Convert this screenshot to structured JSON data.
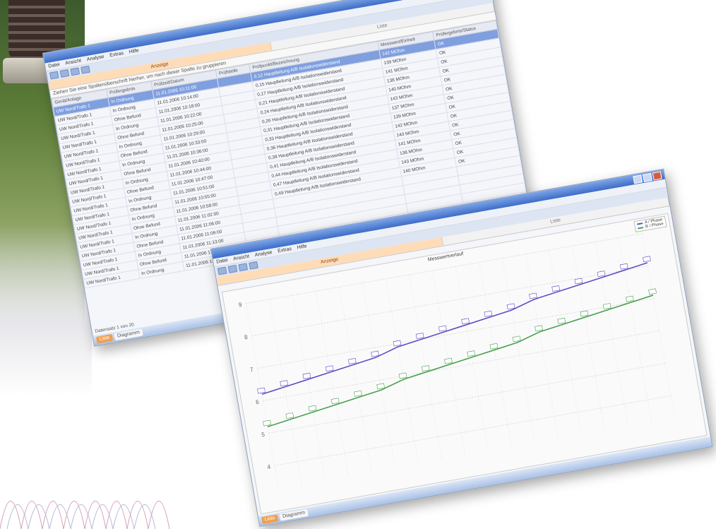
{
  "decor": {
    "photo": "substation-insulator",
    "wave": "sine-wave-lines"
  },
  "window1": {
    "menu": [
      "Datei",
      "Ansicht",
      "Analyse",
      "Extras",
      "Hilfe"
    ],
    "tabs": [
      "Anzeige",
      "Liste"
    ],
    "status_tabs": [
      "Liste",
      "Diagramm"
    ],
    "filter_text": "Ziehen Sie eine Spaltenüberschrift hierher, um nach dieser Spalte zu gruppieren",
    "columns": [
      "Gerät/Anlage",
      "Prüfergebnis",
      "Prüfzeit/Datum",
      "Prüfstelle",
      "Prüfpunkt/Bezeichnung",
      "Messwert/Einheit",
      "Prüfergebnis/Status"
    ],
    "rows": [
      [
        "UW Nord/Trafo 1",
        "In Ordnung",
        "11.01.2006 10:11:00",
        "",
        "0,12 Hauptleitung A/B Isolationswiderstand",
        "142 MOhm",
        "OK"
      ],
      [
        "UW Nord/Trafo 1",
        "In Ordnung",
        "11.01.2006 10:14:00",
        "",
        "0,15 Hauptleitung A/B Isolationswiderstand",
        "139 MOhm",
        "OK"
      ],
      [
        "UW Nord/Trafo 1",
        "Ohne Befund",
        "11.01.2006 10:18:00",
        "",
        "0,17 Hauptleitung A/B Isolationswiderstand",
        "141 MOhm",
        "OK"
      ],
      [
        "UW Nord/Trafo 1",
        "In Ordnung",
        "11.01.2006 10:22:00",
        "",
        "0,21 Hauptleitung A/B Isolationswiderstand",
        "138 MOhm",
        "OK"
      ],
      [
        "UW Nord/Trafo 1",
        "Ohne Befund",
        "11.01.2006 10:25:00",
        "",
        "0,24 Hauptleitung A/B Isolationswiderstand",
        "140 MOhm",
        "OK"
      ],
      [
        "UW Nord/Trafo 1",
        "In Ordnung",
        "11.01.2006 10:29:00",
        "",
        "0,26 Hauptleitung A/B Isolationswiderstand",
        "143 MOhm",
        "OK"
      ],
      [
        "UW Nord/Trafo 1",
        "Ohne Befund",
        "11.01.2006 10:33:00",
        "",
        "0,31 Hauptleitung A/B Isolationswiderstand",
        "137 MOhm",
        "OK"
      ],
      [
        "UW Nord/Trafo 1",
        "In Ordnung",
        "11.01.2006 10:36:00",
        "",
        "0,33 Hauptleitung A/B Isolationswiderstand",
        "139 MOhm",
        "OK"
      ],
      [
        "UW Nord/Trafo 1",
        "Ohne Befund",
        "11.01.2006 10:40:00",
        "",
        "0,36 Hauptleitung A/B Isolationswiderstand",
        "142 MOhm",
        "OK"
      ],
      [
        "UW Nord/Trafo 1",
        "In Ordnung",
        "11.01.2006 10:44:00",
        "",
        "0,38 Hauptleitung A/B Isolationswiderstand",
        "140 MOhm",
        "OK"
      ],
      [
        "UW Nord/Trafo 1",
        "Ohne Befund",
        "11.01.2006 10:47:00",
        "",
        "0,41 Hauptleitung A/B Isolationswiderstand",
        "141 MOhm",
        "OK"
      ],
      [
        "UW Nord/Trafo 1",
        "In Ordnung",
        "11.01.2006 10:51:00",
        "",
        "0,44 Hauptleitung A/B Isolationswiderstand",
        "138 MOhm",
        "OK"
      ],
      [
        "UW Nord/Trafo 1",
        "Ohne Befund",
        "11.01.2006 10:55:00",
        "",
        "0,47 Hauptleitung A/B Isolationswiderstand",
        "143 MOhm",
        "OK"
      ],
      [
        "UW Nord/Trafo 1",
        "In Ordnung",
        "11.01.2006 10:58:00",
        "",
        "0,49 Hauptleitung A/B Isolationswiderstand",
        "140 MOhm",
        "OK"
      ],
      [
        "UW Nord/Trafo 1",
        "Ohne Befund",
        "11.01.2006 11:02:00",
        "",
        "",
        "",
        ""
      ],
      [
        "UW Nord/Trafo 1",
        "In Ordnung",
        "11.01.2006 11:06:00",
        "",
        "",
        "",
        ""
      ],
      [
        "UW Nord/Trafo 1",
        "Ohne Befund",
        "11.01.2006 11:09:00",
        "",
        "",
        "",
        ""
      ],
      [
        "UW Nord/Trafo 1",
        "In Ordnung",
        "11.01.2006 11:13:00",
        "",
        "",
        "",
        ""
      ],
      [
        "UW Nord/Trafo 1",
        "Ohne Befund",
        "11.01.2006 11:17:00",
        "",
        "",
        "",
        ""
      ],
      [
        "UW Nord/Trafo 1",
        "In Ordnung",
        "11.01.2006 11:20:00",
        "",
        "",
        "",
        ""
      ]
    ],
    "pager": "Datensatz 1 von 20"
  },
  "window2": {
    "menu": [
      "Datei",
      "Ansicht",
      "Analyse",
      "Extras",
      "Hilfe"
    ],
    "tabs": [
      "Anzeige",
      "Liste"
    ],
    "status_tabs": [
      "Liste",
      "Diagramm"
    ],
    "chart_title": "Messwertverlauf"
  },
  "chart_data": {
    "type": "line",
    "title": "Messwertverlauf",
    "legend_position": "top-right",
    "grid": true,
    "series": [
      {
        "name": "A / Phase",
        "color": "#5b4fc8",
        "values": [
          6.2,
          6.3,
          6.4,
          6.5,
          6.6,
          6.7,
          6.9,
          7.0,
          7.1,
          7.2,
          7.3,
          7.4,
          7.6,
          7.7,
          7.8,
          7.9,
          8.0,
          8.1
        ]
      },
      {
        "name": "B / Phase",
        "color": "#4aa050",
        "values": [
          5.2,
          5.3,
          5.4,
          5.5,
          5.6,
          5.7,
          5.9,
          6.0,
          6.1,
          6.2,
          6.3,
          6.4,
          6.6,
          6.7,
          6.8,
          6.9,
          7.0,
          7.1
        ]
      }
    ],
    "ylim": [
      4,
      9
    ]
  }
}
